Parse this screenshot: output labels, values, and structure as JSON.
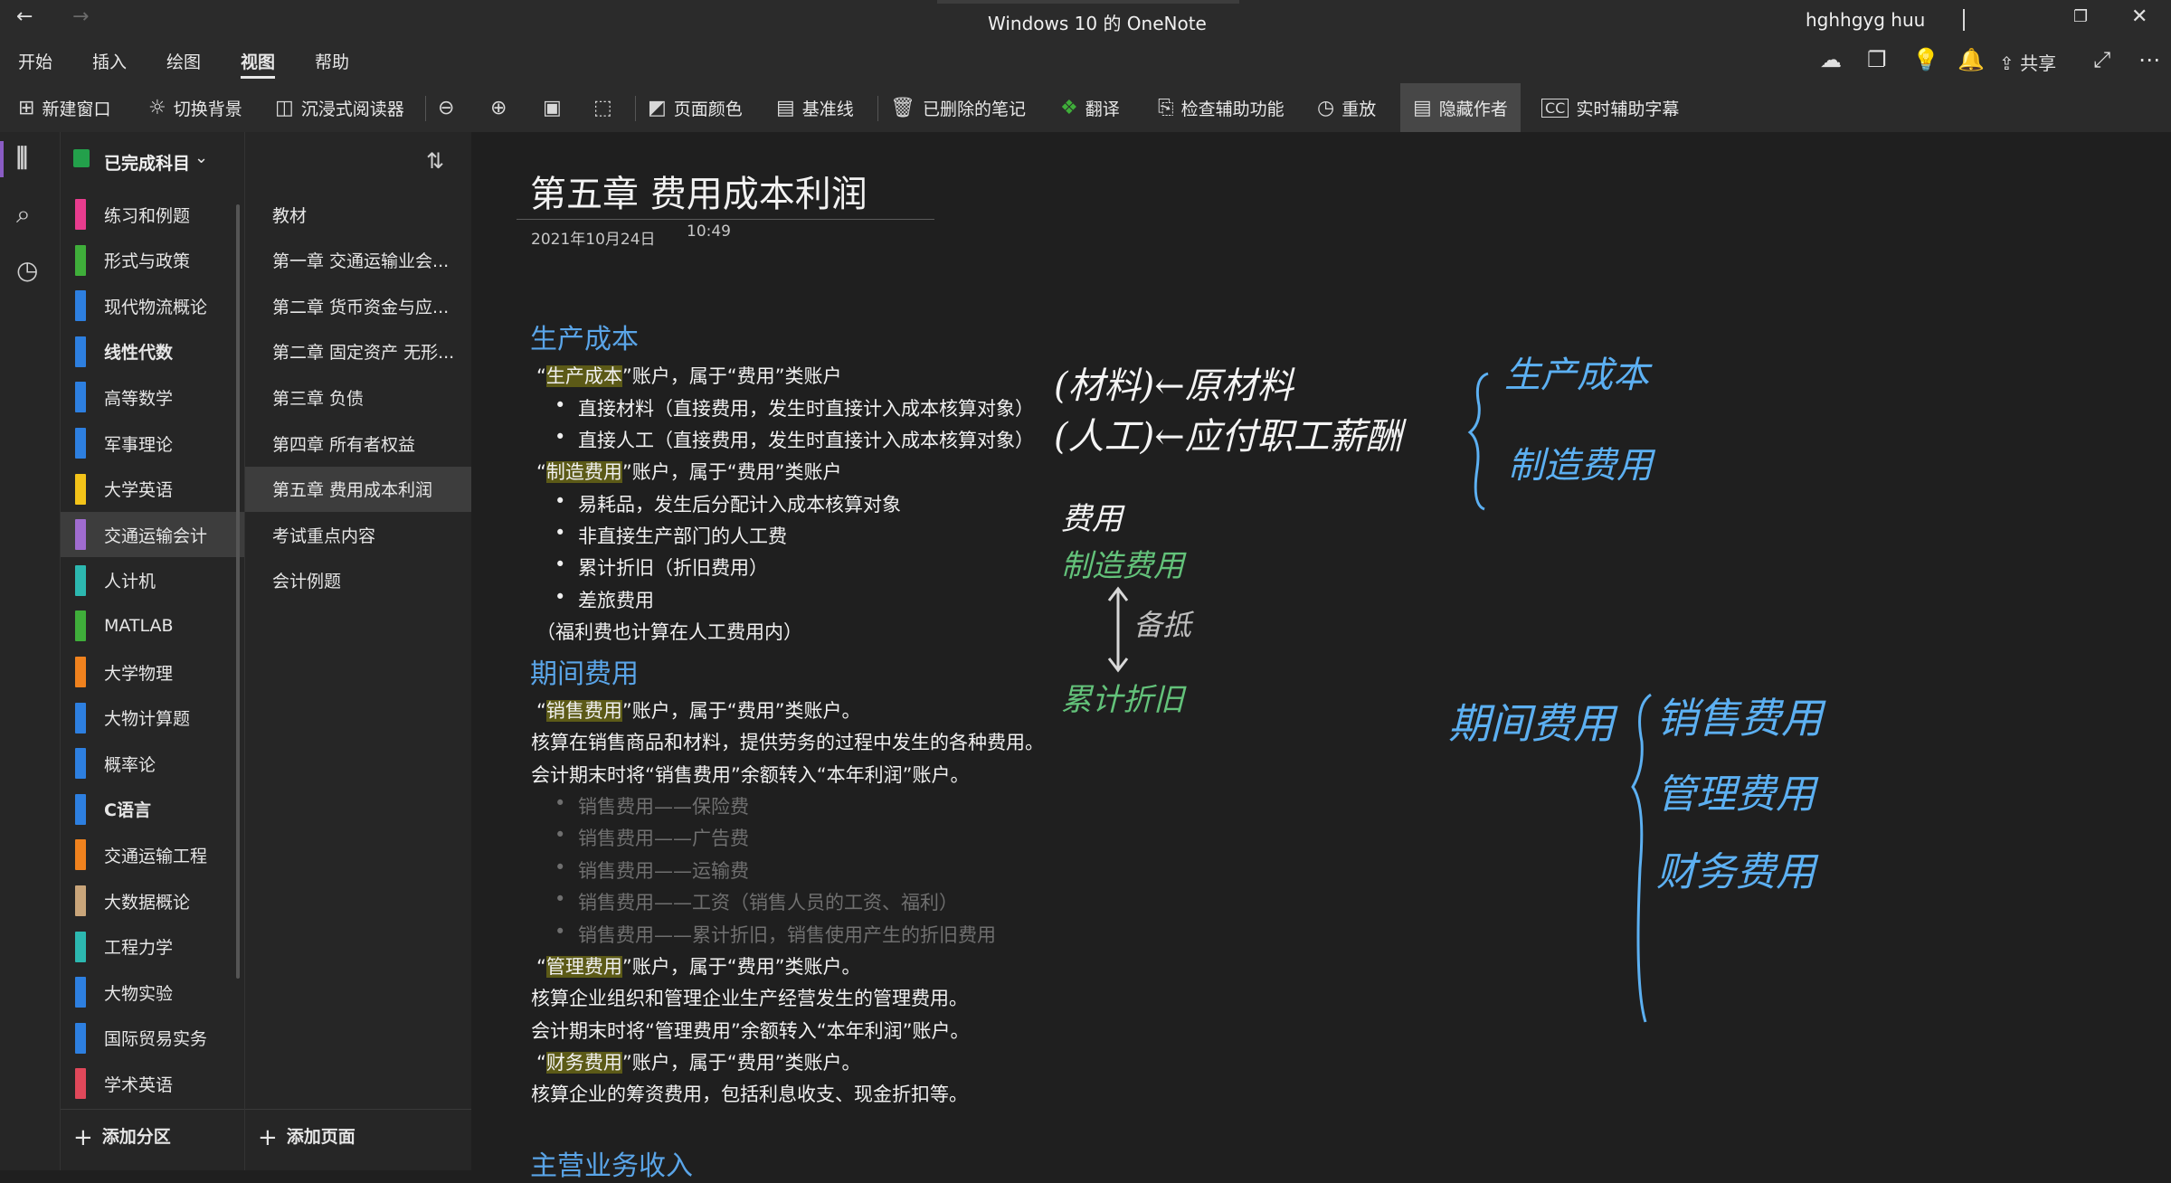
{
  "titlebar": {
    "title": "Windows 10 的 OneNote",
    "user": "hghhgyg huu"
  },
  "menu": {
    "tabs": [
      "开始",
      "插入",
      "绘图",
      "视图",
      "帮助"
    ],
    "share": "共享"
  },
  "toolbar": {
    "new_window": "新建窗口",
    "toggle_bg": "切换背景",
    "immersive_reader": "沉浸式阅读器",
    "page_color": "页面颜色",
    "rule_lines": "基准线",
    "deleted_notes": "已删除的笔记",
    "translate": "翻译",
    "accessibility": "检查辅助功能",
    "replay": "重放",
    "hide_authors": "隐藏作者",
    "captions": "实时辅助字幕"
  },
  "notebook": {
    "name": "已完成科目"
  },
  "sections": [
    {
      "label": "练习和例题",
      "color": "#e83c8e"
    },
    {
      "label": "形式与政策",
      "color": "#3fae3a"
    },
    {
      "label": "现代物流概论",
      "color": "#2d7fe0"
    },
    {
      "label": "线性代数",
      "color": "#2d7fe0"
    },
    {
      "label": "高等数学",
      "color": "#2d7fe0"
    },
    {
      "label": "军事理论",
      "color": "#2d7fe0"
    },
    {
      "label": "大学英语",
      "color": "#f3c319"
    },
    {
      "label": "交通运输会计",
      "color": "#a06cd0"
    },
    {
      "label": "人计机",
      "color": "#2cb8b0"
    },
    {
      "label": "MATLAB",
      "color": "#3fae3a"
    },
    {
      "label": "大学物理",
      "color": "#f0821e"
    },
    {
      "label": "大物计算题",
      "color": "#2d7fe0"
    },
    {
      "label": "概率论",
      "color": "#2d7fe0"
    },
    {
      "label": "C语言",
      "color": "#2d7fe0"
    },
    {
      "label": "交通运输工程",
      "color": "#f0821e"
    },
    {
      "label": "大数据概论",
      "color": "#c9a57a"
    },
    {
      "label": "工程力学",
      "color": "#2cb8b0"
    },
    {
      "label": "大物实验",
      "color": "#2d7fe0"
    },
    {
      "label": "国际贸易实务",
      "color": "#2d7fe0"
    },
    {
      "label": "学术英语",
      "color": "#e0485a"
    }
  ],
  "add_section": "添加分区",
  "pages": [
    "教材",
    "第一章 交通运输业会...",
    "第二章 货币资金与应...",
    "第二章 固定资产 无形...",
    "第三章 负债",
    "第四章 所有者权益",
    "第五章 费用成本利润",
    "考试重点内容",
    "会计例题"
  ],
  "add_page": "添加页面",
  "note": {
    "title": "第五章 费用成本利润",
    "date": "2021年10月24日",
    "time": "10:49",
    "h1": "生产成本",
    "l1_q1": "“",
    "l1_hl": "生产成本",
    "l1_rest": "”账户，属于“费用”类账户",
    "b1": "直接材料（直接费用，发生时直接计入成本核算对象）",
    "b2": "直接人工（直接费用，发生时直接计入成本核算对象）",
    "l2_q1": "“",
    "l2_hl": "制造费用",
    "l2_rest": "”账户，属于“费用”类账户",
    "b3": "易耗品，发生后分配计入成本核算对象",
    "b4": "非直接生产部门的人工费",
    "b5": "累计折旧（折旧费用）",
    "b6": "差旅费用",
    "l3": "（福利费也计算在人工费用内）",
    "h2": "期间费用",
    "l4_q1": "“",
    "l4_hl": "销售费用",
    "l4_rest": "”账户，属于“费用”类账户。",
    "l5": "核算在销售商品和材料，提供劳务的过程中发生的各种费用。",
    "l6": "会计期末时将“销售费用”余额转入“本年利润”账户。",
    "d1": "销售费用——保险费",
    "d2": "销售费用——广告费",
    "d3": "销售费用——运输费",
    "d4": "销售费用——工资（销售人员的工资、福利）",
    "d5": "销售费用——累计折旧，销售使用产生的折旧费用",
    "l7_q1": "“",
    "l7_hl": "管理费用",
    "l7_rest": "”账户，属于“费用”类账户。",
    "l8": "核算企业组织和管理企业生产经营发生的管理费用。",
    "l9": "会计期末时将“管理费用”余额转入“本年利润”账户。",
    "l10_q1": "“",
    "l10_hl": "财务费用",
    "l10_rest": "”账户，属于“费用”类账户。",
    "l11": "核算企业的筹资费用，包括利息收支、现金折扣等。",
    "h3": "主营业务收入"
  },
  "ink": {
    "w1": "(材料)←原材料",
    "w2": "(人工)←应付职工薪酬",
    "w3": "费用",
    "g1": "制造费用",
    "w4": "备抵",
    "g2": "累计折旧",
    "b1": "生产成本",
    "b2": "制造费用",
    "b3": "期间费用",
    "b4": "销售费用",
    "b5": "管理费用",
    "b6": "财务费用"
  }
}
